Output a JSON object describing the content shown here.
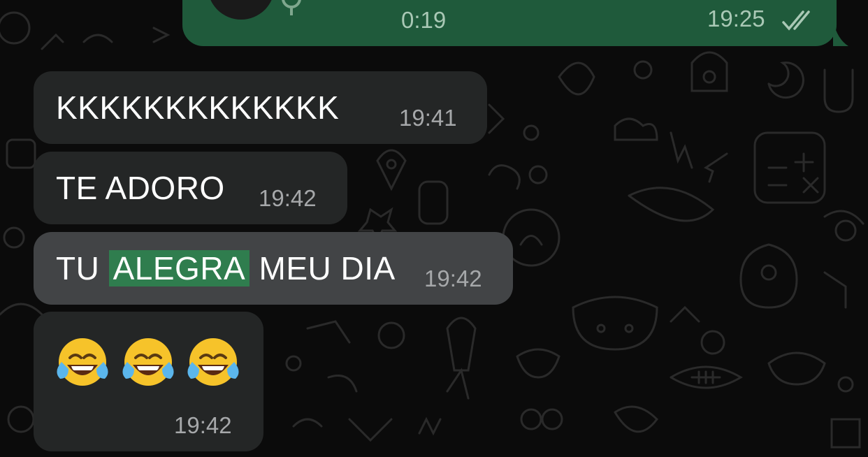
{
  "chat": {
    "outgoing_voice": {
      "duration": "0:19",
      "time": "19:25",
      "status": "read-double-check-icon"
    },
    "messages": [
      {
        "text": "KKKKKKKKKKKKK",
        "time": "19:41"
      },
      {
        "text": "TE ADORO",
        "time": "19:42"
      },
      {
        "text_before": "TU ",
        "highlight": "ALEGRA",
        "text_after": " MEU DIA",
        "time": "19:42"
      },
      {
        "emojis": [
          "😂",
          "😂",
          "😂"
        ],
        "emoji_icon": "tears-of-joy-emoji-icon",
        "time": "19:42"
      }
    ]
  },
  "colors": {
    "background": "#0b0b0b",
    "incoming_bubble": "#242626",
    "highlighted_bubble": "#424446",
    "outgoing_bubble": "#1f5a3b",
    "search_highlight": "#2f7d4e"
  }
}
